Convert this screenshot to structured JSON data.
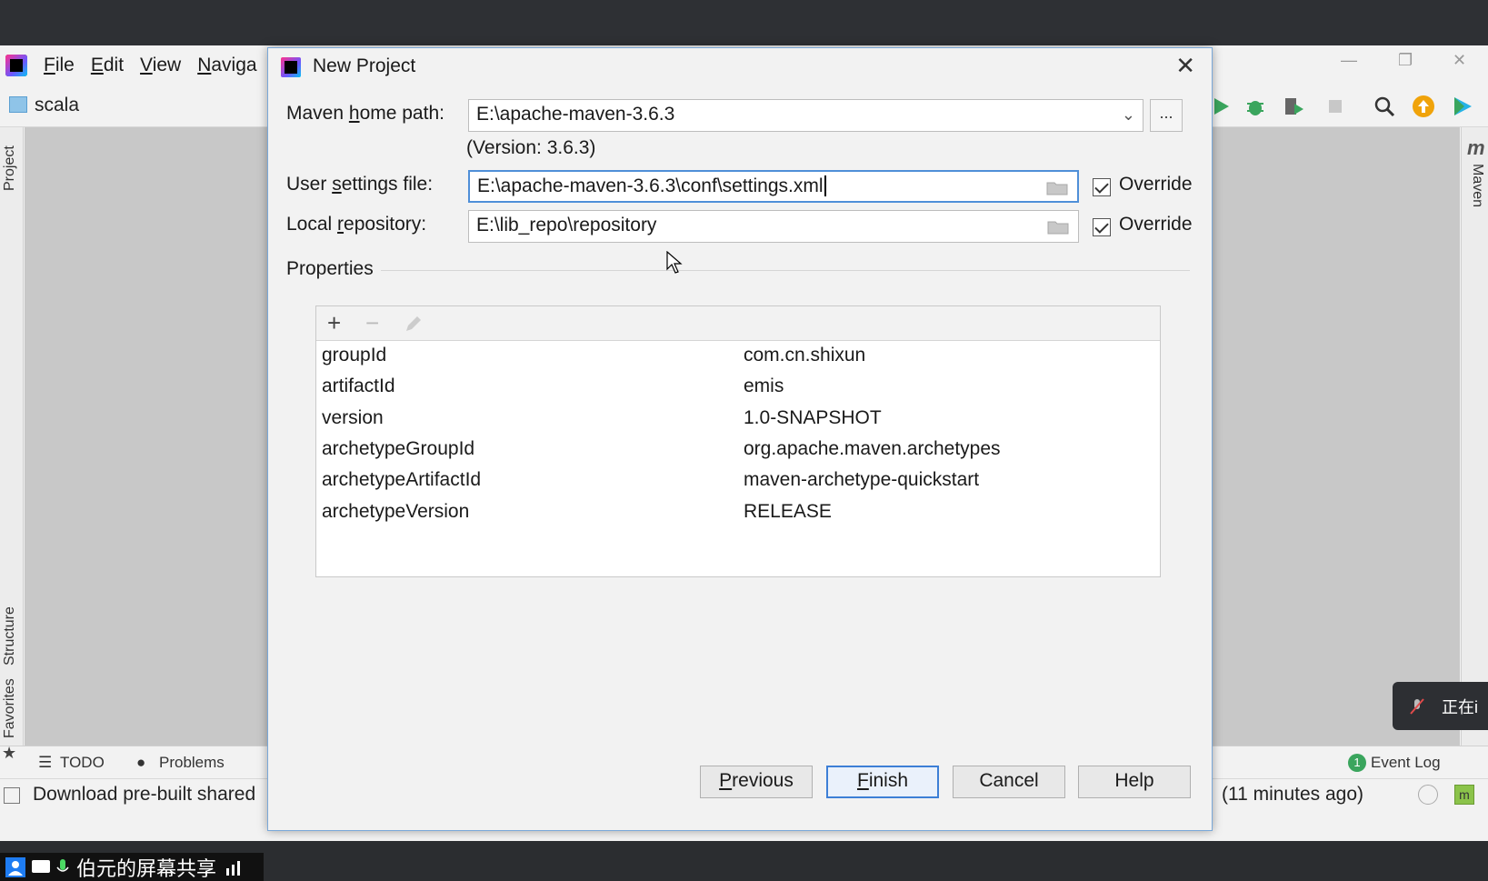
{
  "ide": {
    "menu": [
      "File",
      "Edit",
      "View",
      "Naviga"
    ],
    "project_name": "scala",
    "left_tabs": [
      "Project",
      "Structure",
      "Favorites"
    ],
    "right_tabs": [
      "Maven"
    ],
    "bottom_tabs": [
      "TODO",
      "Problems"
    ],
    "event_log": "Event Log",
    "event_log_count": "1",
    "status_left": "Download pre-built shared",
    "status_right": "(11 minutes ago)"
  },
  "dialog": {
    "title": "New Project",
    "close_glyph": "✕",
    "maven_home": {
      "label": "Maven home path:",
      "value": "E:\\apache-maven-3.6.3",
      "version": "(Version: 3.6.3)",
      "browse": "..."
    },
    "user_settings": {
      "label": "User settings file:",
      "value": "E:\\apache-maven-3.6.3\\conf\\settings.xml",
      "override_label": "Override",
      "override_checked": true
    },
    "local_repo": {
      "label": "Local repository:",
      "value": "E:\\lib_repo\\repository",
      "override_label": "Override",
      "override_checked": true
    },
    "properties_title": "Properties",
    "properties": [
      {
        "key": "groupId",
        "value": "com.cn.shixun"
      },
      {
        "key": "artifactId",
        "value": "emis"
      },
      {
        "key": "version",
        "value": "1.0-SNAPSHOT"
      },
      {
        "key": "archetypeGroupId",
        "value": "org.apache.maven.archetypes"
      },
      {
        "key": "archetypeArtifactId",
        "value": "maven-archetype-quickstart"
      },
      {
        "key": "archetypeVersion",
        "value": "RELEASE"
      }
    ],
    "buttons": {
      "previous": "Previous",
      "finish": "Finish",
      "cancel": "Cancel",
      "help": "Help"
    }
  },
  "overlay": {
    "share_text": "伯元的屏幕共享",
    "rec_text": "正在i"
  }
}
